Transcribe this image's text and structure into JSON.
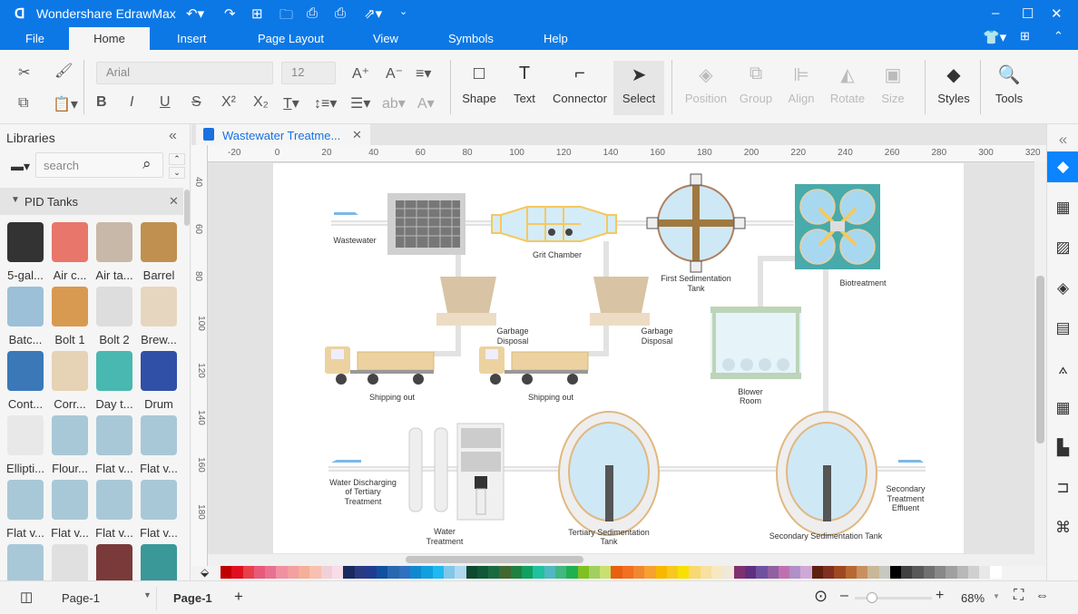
{
  "app": {
    "title": "Wondershare EdrawMax",
    "accent": "#0c78e6"
  },
  "menu": [
    "File",
    "Home",
    "Insert",
    "Page Layout",
    "View",
    "Symbols",
    "Help"
  ],
  "ribbon": {
    "font": "Arial",
    "size": "12",
    "shape": "Shape",
    "text": "Text",
    "connector": "Connector",
    "select": "Select",
    "position": "Position",
    "group": "Group",
    "align": "Align",
    "rotate": "Rotate",
    "size_btn": "Size",
    "styles": "Styles",
    "tools": "Tools"
  },
  "left": {
    "title": "Libraries",
    "search_placeholder": "search",
    "category": "PID Tanks",
    "items": [
      {
        "label": "5-gal...",
        "color": "#333"
      },
      {
        "label": "Air c...",
        "color": "#e8766a"
      },
      {
        "label": "Air ta...",
        "color": "#c8b8a8"
      },
      {
        "label": "Barrel",
        "color": "#c09050"
      },
      {
        "label": "Batc...",
        "color": "#9cc0d8"
      },
      {
        "label": "Bolt 1",
        "color": "#d89a50"
      },
      {
        "label": "Bolt 2",
        "color": "#ddd"
      },
      {
        "label": "Brew...",
        "color": "#e6d6c0"
      },
      {
        "label": "Cont...",
        "color": "#3a78b8"
      },
      {
        "label": "Corr...",
        "color": "#e6d2b4"
      },
      {
        "label": "Day t...",
        "color": "#48b8b0"
      },
      {
        "label": "Drum",
        "color": "#3050a8"
      },
      {
        "label": "Ellipti...",
        "color": "#e8e8e8"
      },
      {
        "label": "Flour...",
        "color": "#a8c8d8"
      },
      {
        "label": "Flat v...",
        "color": "#a8c8d8"
      },
      {
        "label": "Flat v...",
        "color": "#a8c8d8"
      },
      {
        "label": "Flat v...",
        "color": "#a8c8d8"
      },
      {
        "label": "Flat v...",
        "color": "#a8c8d8"
      },
      {
        "label": "Flat v...",
        "color": "#a8c8d8"
      },
      {
        "label": "Flat v...",
        "color": "#a8c8d8"
      },
      {
        "label": "",
        "color": "#a8c8d8"
      },
      {
        "label": "",
        "color": "#e0e0e0"
      },
      {
        "label": "",
        "color": "#7a3a3a"
      },
      {
        "label": "",
        "color": "#3a9898"
      }
    ]
  },
  "document": {
    "tab": "Wastewater Treatme..."
  },
  "ruler": {
    "top": [
      "-20",
      "0",
      "20",
      "40",
      "60",
      "80",
      "100",
      "120",
      "140",
      "160",
      "180",
      "200",
      "220",
      "240",
      "260",
      "280",
      "300",
      "320"
    ],
    "left": [
      "40",
      "60",
      "80",
      "100",
      "120",
      "140",
      "160",
      "180"
    ]
  },
  "diagram": {
    "wastewater": "Wastewater",
    "grit": "Grit Chamber",
    "first1": "First Sedimentation",
    "first2": "Tank",
    "bio": "Biotreatment",
    "garbage1": "Garbage",
    "garbage2": "Disposal",
    "shipping": "Shipping out",
    "blower1": "Blower",
    "blower2": "Room",
    "discharge1": "Water Discharging",
    "discharge2": "of Tertiary",
    "discharge3": "Treatment",
    "water1": "Water",
    "water2": "Treatment",
    "tertiary1": "Tertiary Sedimentation",
    "tertiary2": "Tank",
    "secondary": "Secondary Sedimentation Tank",
    "eff1": "Secondary",
    "eff2": "Treatment",
    "eff3": "Effluent"
  },
  "palette": [
    "#c00000",
    "#e01020",
    "#e8404a",
    "#e85a7a",
    "#e87090",
    "#f090a0",
    "#f4a0a0",
    "#f4b098",
    "#f8c0b0",
    "#f0d0d8",
    "#f8dce8",
    "#1a2a60",
    "#2a3a80",
    "#203c90",
    "#1050a0",
    "#2868b0",
    "#3070c0",
    "#1088d0",
    "#10a0e0",
    "#20b8f0",
    "#80c8e8",
    "#b0d8f0",
    "#104830",
    "#105838",
    "#1a6a40",
    "#406830",
    "#208040",
    "#10a060",
    "#20c0a0",
    "#50b8c0",
    "#40b880",
    "#20b050",
    "#80c020",
    "#a0d060",
    "#c8e070",
    "#e86010",
    "#f07020",
    "#f08830",
    "#f8a030",
    "#f8b800",
    "#f8c820",
    "#f8e000",
    "#f8d870",
    "#f8e0a0",
    "#f8e8c0",
    "#f0e8d8",
    "#803070",
    "#603080",
    "#7050a0",
    "#9060a0",
    "#c070b0",
    "#b090c8",
    "#d0a8d8",
    "#602010",
    "#803020",
    "#a04820",
    "#b86830",
    "#c89060",
    "#c8b898",
    "#c8c8c0",
    "#000000",
    "#404040",
    "#585858",
    "#707070",
    "#888888",
    "#a0a0a0",
    "#b8b8b8",
    "#d0d0d0",
    "#e8e8e8",
    "#ffffff"
  ],
  "status": {
    "page_select": "Page-1",
    "page_tab": "Page-1",
    "zoom": "68%",
    "zoom_level": 0.15
  }
}
